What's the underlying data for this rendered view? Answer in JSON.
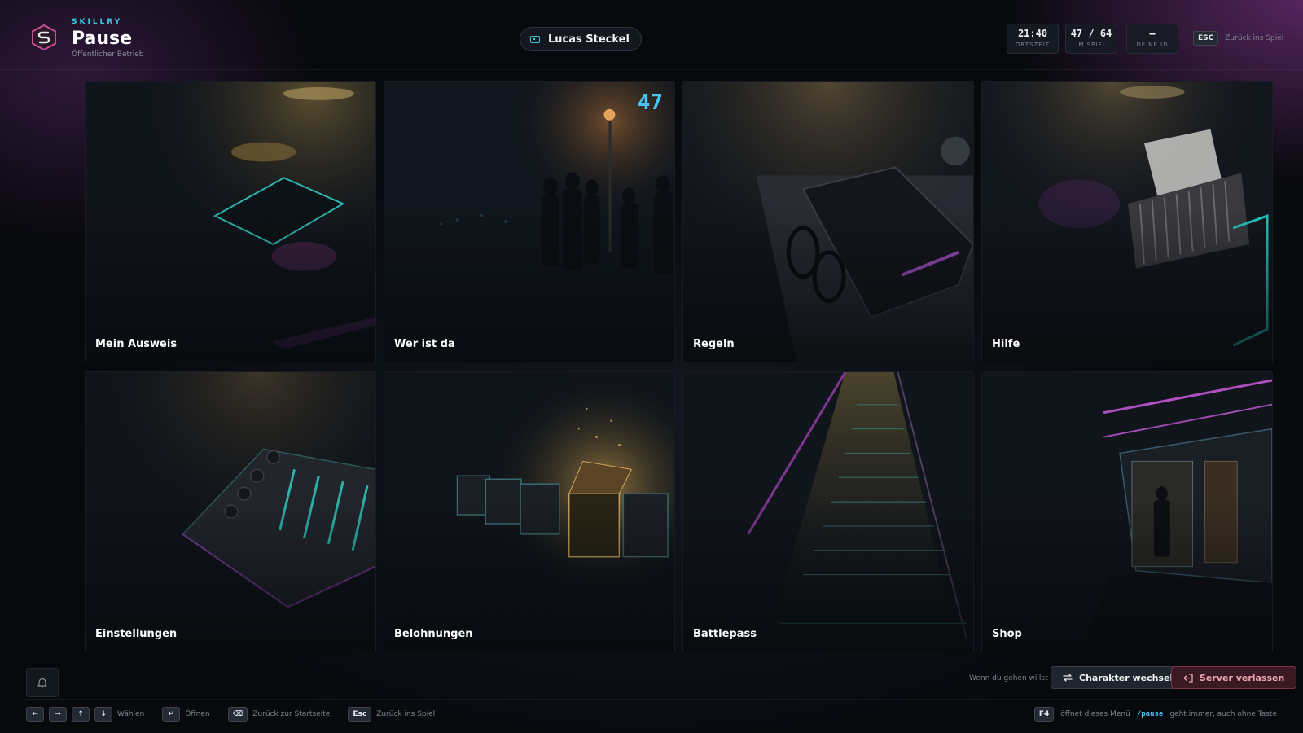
{
  "header": {
    "brand": "SKILLRY",
    "title": "Pause",
    "subtitle": "Öffentlicher Betrieb",
    "player_name": "Lucas Steckel",
    "stats": [
      {
        "value": "21:40",
        "label": "ORTSZEIT"
      },
      {
        "value": "47 / 64",
        "label": "IM SPIEL"
      },
      {
        "value": "–",
        "label": "DEINE ID"
      }
    ],
    "esc_key": "ESC",
    "esc_label": "Zurück ins Spiel"
  },
  "tiles": [
    {
      "label": "Mein Ausweis"
    },
    {
      "label": "Wer ist da",
      "count": "47"
    },
    {
      "label": "Regeln"
    },
    {
      "label": "Hilfe"
    },
    {
      "label": "Einstellungen"
    },
    {
      "label": "Belohnungen"
    },
    {
      "label": "Battlepass"
    },
    {
      "label": "Shop"
    }
  ],
  "footer": {
    "leave_hint": "Wenn du gehen willst",
    "switch_label": "Charakter wechseln",
    "leave_label": "Server verlassen",
    "hints": {
      "arrows": [
        "←",
        "→",
        "↑",
        "↓"
      ],
      "select_label": "Wählen",
      "enter_key": "↵",
      "open_label": "Öffnen",
      "back_key": "⌫",
      "back_label": "Zurück zur Startseite",
      "esc_key": "Esc",
      "esc_label": "Zurück ins Spiel",
      "f4_key": "F4",
      "f4_label": "öffnet dieses Menü",
      "pause_cmd": "/pause",
      "pause_label": "geht immer, auch ohne Taste"
    }
  },
  "colors": {
    "accent": "#45c3ef",
    "danger": "#f0a6b2",
    "brand_magenta": "#c94f9a"
  }
}
